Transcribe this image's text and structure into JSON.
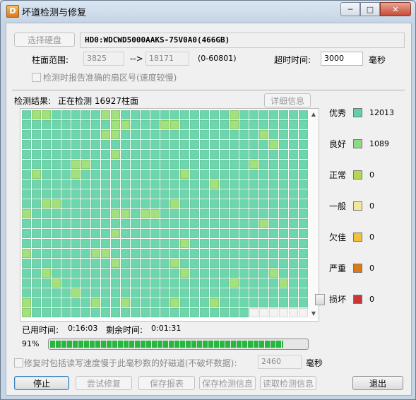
{
  "window": {
    "title": "坏道检测与修复"
  },
  "controls": {
    "select_disk": "选择硬盘",
    "drive_info": "HD0:WDCWD5000AAKS-75V0A0(466GB)",
    "cylinder_range_label": "柱面范围:",
    "cyl_start": "3825",
    "range_arrow": "-->",
    "cyl_end": "18171",
    "cyl_total": "(0-60801)",
    "timeout_label": "超时时间:",
    "timeout_value": "3000",
    "timeout_unit": "毫秒",
    "report_sector_label": "检测时报告准确的扇区号(速度较慢)"
  },
  "status": {
    "result_label": "检测结果:",
    "result_text": "正在检测  16927柱面",
    "details_button": "详细信息"
  },
  "legend": [
    {
      "name": "优秀",
      "count": "12013",
      "color": "#5fd0a9"
    },
    {
      "name": "良好",
      "count": "1089",
      "color": "#8ed985"
    },
    {
      "name": "正常",
      "count": "0",
      "color": "#b3d84f"
    },
    {
      "name": "一般",
      "count": "0",
      "color": "#f5e79a"
    },
    {
      "name": "欠佳",
      "count": "0",
      "color": "#f0c23a"
    },
    {
      "name": "严重",
      "count": "0",
      "color": "#d97c17"
    },
    {
      "name": "损坏",
      "count": "0",
      "color": "#c8363a"
    }
  ],
  "time": {
    "elapsed_label": "已用时间:",
    "elapsed": "0:16:03",
    "remaining_label": "剩余时间:",
    "remaining": "0:01:31"
  },
  "progress": {
    "percent_text": "91%",
    "value": 0.91
  },
  "repair_option": {
    "label": "修复时包括读写速度慢于此毫秒数的好磁道(不破坏数据):",
    "value": "2460",
    "unit": "毫秒"
  },
  "buttons": {
    "stop": "停止",
    "try_repair": "尝试修复",
    "save_report": "保存报表",
    "save_detect": "保存检测信息",
    "read_detect": "读取检测信息",
    "exit": "退出"
  }
}
